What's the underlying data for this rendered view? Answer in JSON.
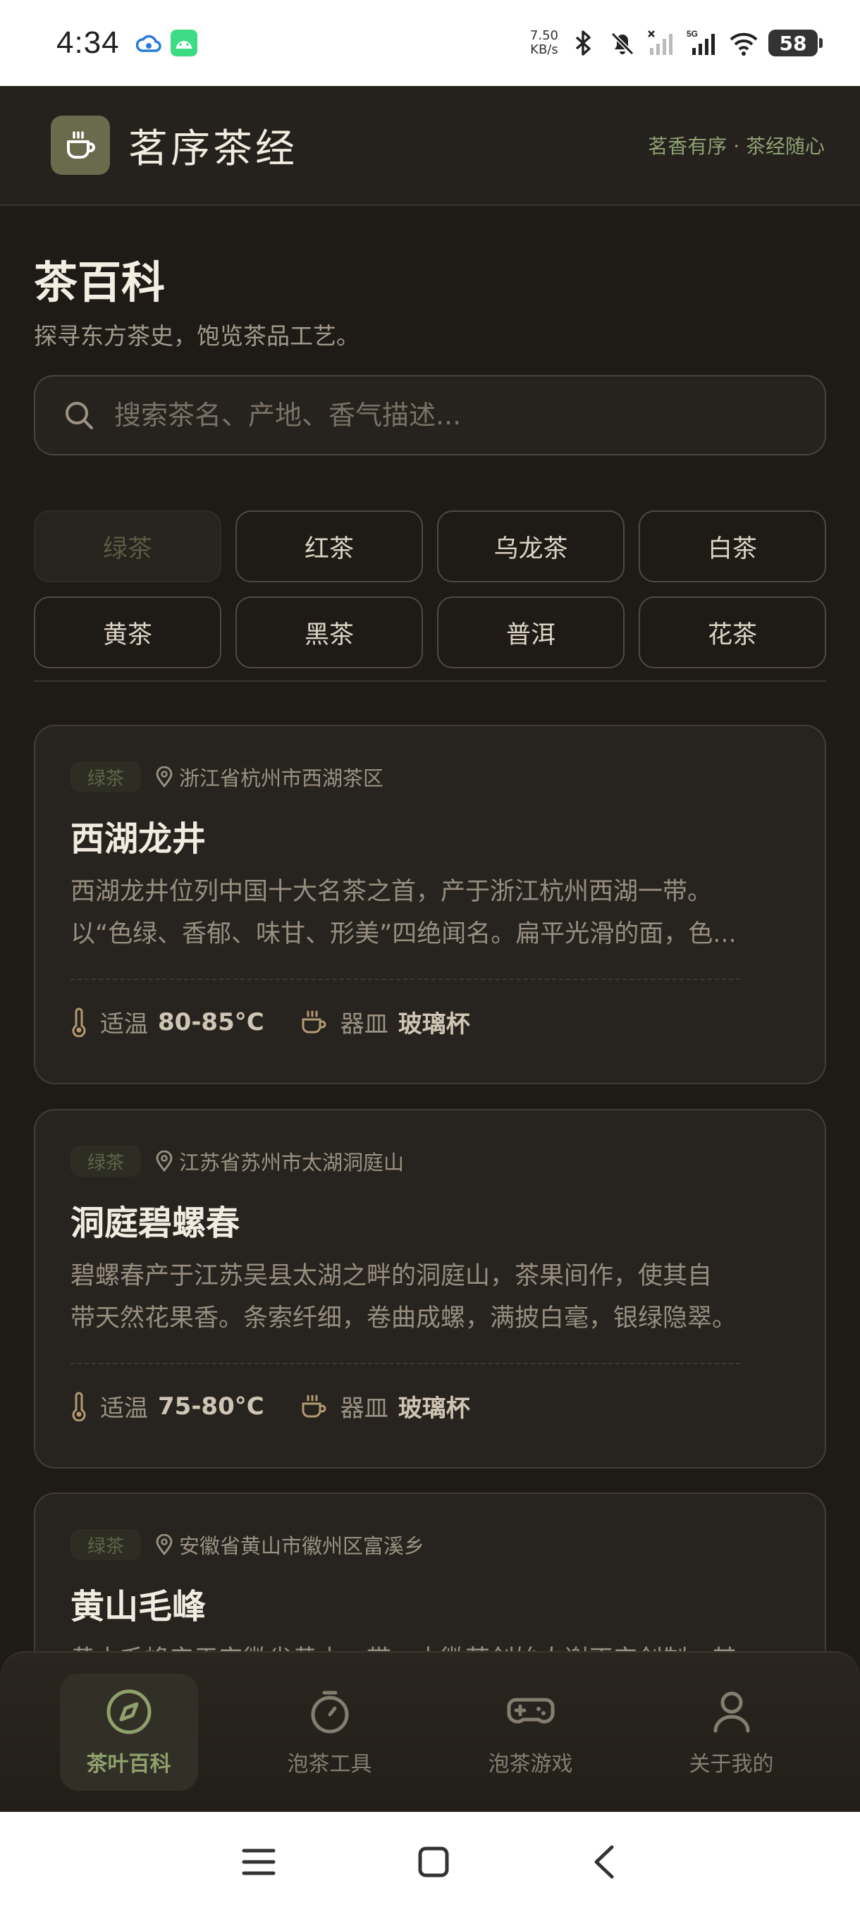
{
  "status_bar": {
    "time": "4:34",
    "net_speed_value": "7.50",
    "net_speed_unit": "KB/s",
    "network": "5G",
    "battery": "58",
    "icons": [
      "cloud-icon",
      "android-icon",
      "bluetooth-icon",
      "mute-icon",
      "signal-icon",
      "wifi-icon",
      "battery-icon"
    ]
  },
  "header": {
    "app_title": "茗序茶经",
    "slogan": "茗香有序 · 茶经随心",
    "logo_icon": "teacup-icon"
  },
  "page": {
    "title": "茶百科",
    "subtitle": "探寻东方茶史，饱览茶品工艺。"
  },
  "search": {
    "placeholder": "搜索茶名、产地、香气描述..."
  },
  "categories": [
    "绿茶",
    "红茶",
    "乌龙茶",
    "白茶",
    "黄茶",
    "黑茶",
    "普洱",
    "花茶"
  ],
  "selected_category": "绿茶",
  "teas": [
    {
      "tag": "绿茶",
      "origin": "浙江省杭州市西湖茶区",
      "name": "西湖龙井",
      "desc_line1": "西湖龙井位列中国十大名茶之首，产于浙江杭州西湖一带。",
      "desc_line2": "以“色绿、香郁、味甘、形美”四绝闻名。扁平光滑的面，色...",
      "temp_label": "适温",
      "temp": "80-85°C",
      "vessel_label": "器皿",
      "vessel": "玻璃杯"
    },
    {
      "tag": "绿茶",
      "origin": "江苏省苏州市太湖洞庭山",
      "name": "洞庭碧螺春",
      "desc_line1": "碧螺春产于江苏吴县太湖之畔的洞庭山，茶果间作，使其自",
      "desc_line2": "带天然花果香。条索纤细，卷曲成螺，满披白毫，银绿隐翠。",
      "temp_label": "适温",
      "temp": "75-80°C",
      "vessel_label": "器皿",
      "vessel": "玻璃杯"
    },
    {
      "tag": "绿茶",
      "origin": "安徽省黄山市徽州区富溪乡",
      "name": "黄山毛峰",
      "desc_line1": "黄山毛峰产于安徽省黄山一带，由徽茶创始人谢正安创制，其叶色微黄",
      "desc_line2": "",
      "temp_label": "适温",
      "temp": "",
      "vessel_label": "器皿",
      "vessel": ""
    }
  ],
  "bottom_nav": [
    {
      "label": "茶叶百科",
      "icon": "compass-icon",
      "active": true
    },
    {
      "label": "泡茶工具",
      "icon": "timer-icon",
      "active": false
    },
    {
      "label": "泡茶游戏",
      "icon": "gamepad-icon",
      "active": false
    },
    {
      "label": "关于我的",
      "icon": "user-icon",
      "active": false
    }
  ],
  "colors": {
    "background": "#1e1a16",
    "card": "#27231e",
    "accent_green": "#8ea06c",
    "muted_text": "#978e80"
  }
}
